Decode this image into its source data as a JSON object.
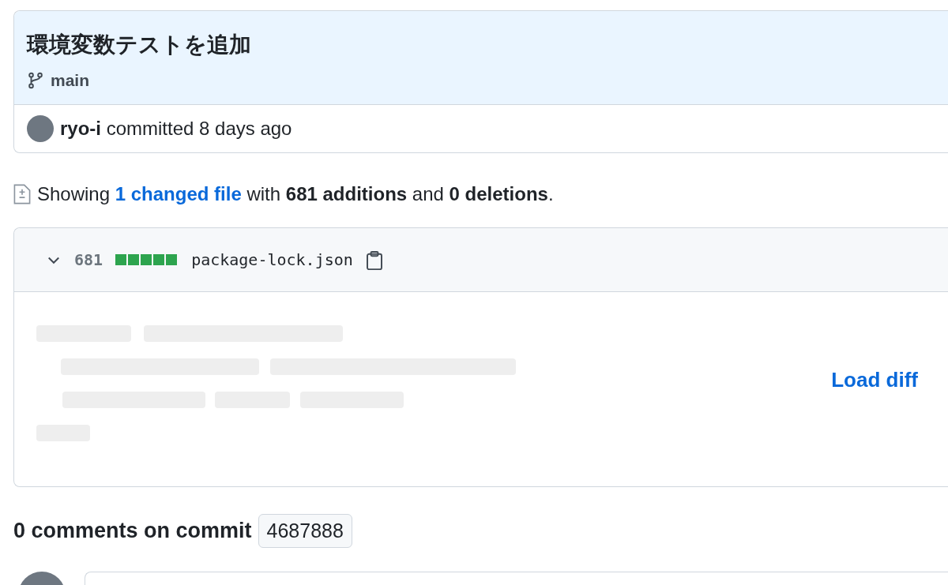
{
  "commit": {
    "title": "環境変数テストを追加",
    "branch": "main",
    "author": "ryo-i",
    "action": "committed 8 days ago"
  },
  "summary": {
    "before": "Showing",
    "link": "1 changed file",
    "after": "with **681 additions** and **0 deletions**."
  },
  "file": {
    "expanded": true,
    "count": "681",
    "diffstat": [
      {
        "kind": "added"
      },
      {
        "kind": "added"
      },
      {
        "kind": "added"
      },
      {
        "kind": "added"
      },
      {
        "kind": "added"
      }
    ],
    "name": "package-lock.json",
    "load_label": "Load diff"
  },
  "comments": {
    "heading": "0 comments on commit",
    "sha": "4687888"
  }
}
